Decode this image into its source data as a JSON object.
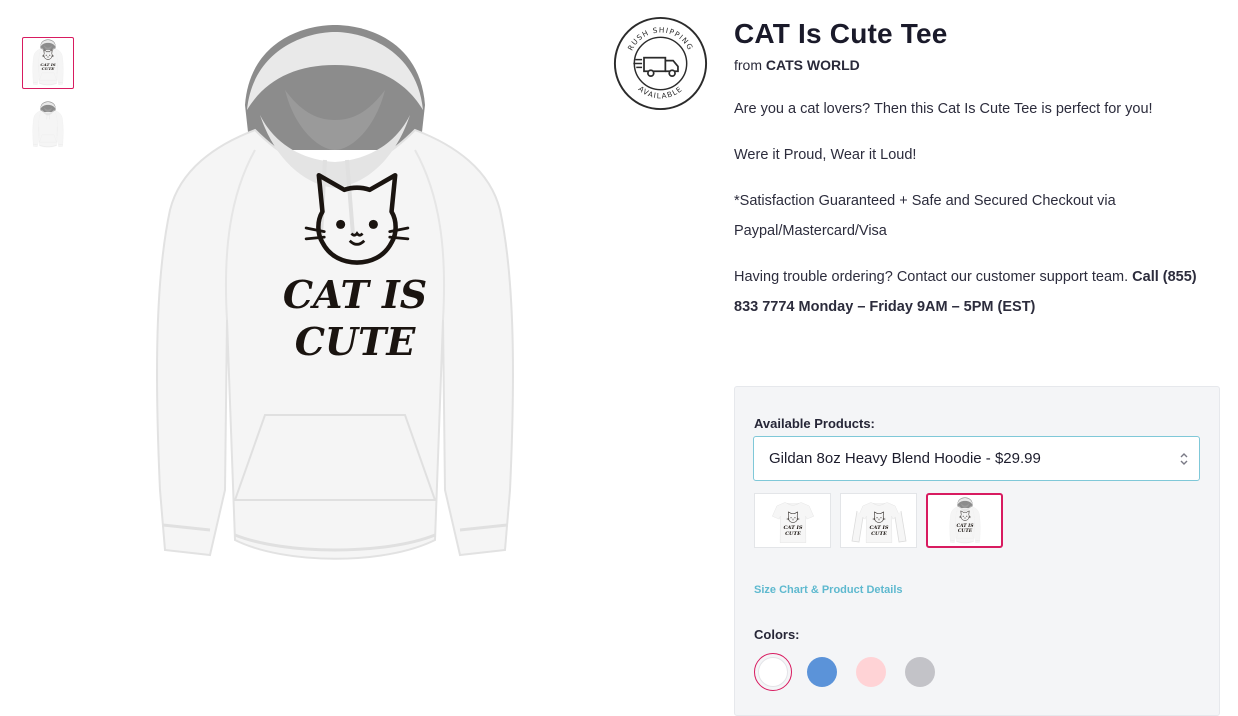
{
  "product": {
    "title": "CAT Is Cute Tee",
    "from_label": "from",
    "store": "CATS WORLD"
  },
  "badge": {
    "top_text": "RUSH SHIPPING",
    "bottom_text": "AVAILABLE"
  },
  "design_text": {
    "line1": "CAT IS",
    "line2": "CUTE"
  },
  "description": {
    "p1": "Are you a cat lovers? Then this Cat Is Cute Tee is perfect for you!",
    "p2": "Were it Proud, Wear it Loud!",
    "p3": "*Satisfaction Guaranteed + Safe and Secured Checkout via Paypal/Mastercard/Visa",
    "p4_text": "Having trouble ordering? Contact our customer support team. ",
    "p4_bold": "Call (855) 833 7774 Monday – Friday 9AM – 5PM (EST)"
  },
  "selector": {
    "products_label": "Available Products:",
    "selected_product": "Gildan 8oz Heavy Blend Hoodie - $29.99",
    "size_chart_link": "Size Chart & Product Details",
    "colors_label": "Colors:"
  },
  "colors": [
    "#ffffff",
    "#5b93d9",
    "#ffd3d6",
    "#c3c3c8"
  ],
  "accent_color": "#d81b60",
  "icons": [
    "rush-shipping-badge-icon",
    "select-arrows-icon"
  ]
}
